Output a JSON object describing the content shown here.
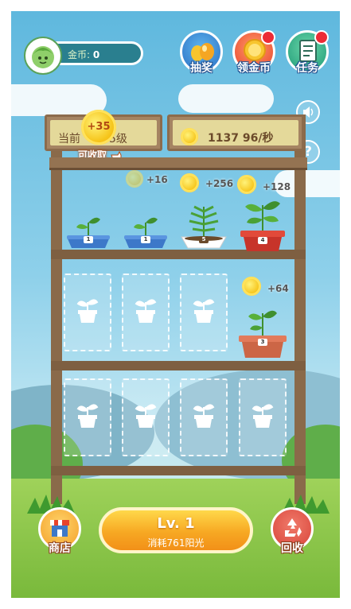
{
  "top": {
    "coin_label": "金币:",
    "coin_value": "0",
    "buttons": [
      {
        "label": "抽奖",
        "icon": "egg-icon",
        "has_dot": false
      },
      {
        "label": "领金币",
        "icon": "gold-coin-icon",
        "has_dot": true
      },
      {
        "label": "任务",
        "icon": "task-list-icon",
        "has_dot": true
      }
    ],
    "side_buttons": [
      "sound-toggle-icon",
      "help-icon"
    ]
  },
  "status": {
    "level_prefix": "当前",
    "level_suffix": "5级",
    "bonus": "+35",
    "collect_label": "可收取",
    "sunlight_total": "1137",
    "sunlight_rate": "96/秒"
  },
  "shelf": {
    "row1": [
      {
        "level": "1",
        "pot": "blue",
        "rate": ""
      },
      {
        "level": "1",
        "pot": "blue",
        "rate": "+16"
      },
      {
        "level": "5",
        "pot": "white",
        "rate": "+256"
      },
      {
        "level": "4",
        "pot": "red",
        "rate": "+128"
      }
    ],
    "row2": [
      {
        "empty": true
      },
      {
        "empty": true
      },
      {
        "empty": true
      },
      {
        "level": "3",
        "pot": "terracotta",
        "rate": "+64"
      }
    ],
    "row3": [
      {
        "empty": true
      },
      {
        "empty": true
      },
      {
        "empty": true
      },
      {
        "empty": true
      }
    ]
  },
  "bottom": {
    "shop_label": "商店",
    "upgrade_level": "Lv. 1",
    "upgrade_cost": "消耗761阳光",
    "recycle_label": "回收"
  },
  "colors": {
    "accent_orange": "#f7a823",
    "shelf_wood": "#8a6a4a",
    "badge_red": "#ec2b35"
  }
}
